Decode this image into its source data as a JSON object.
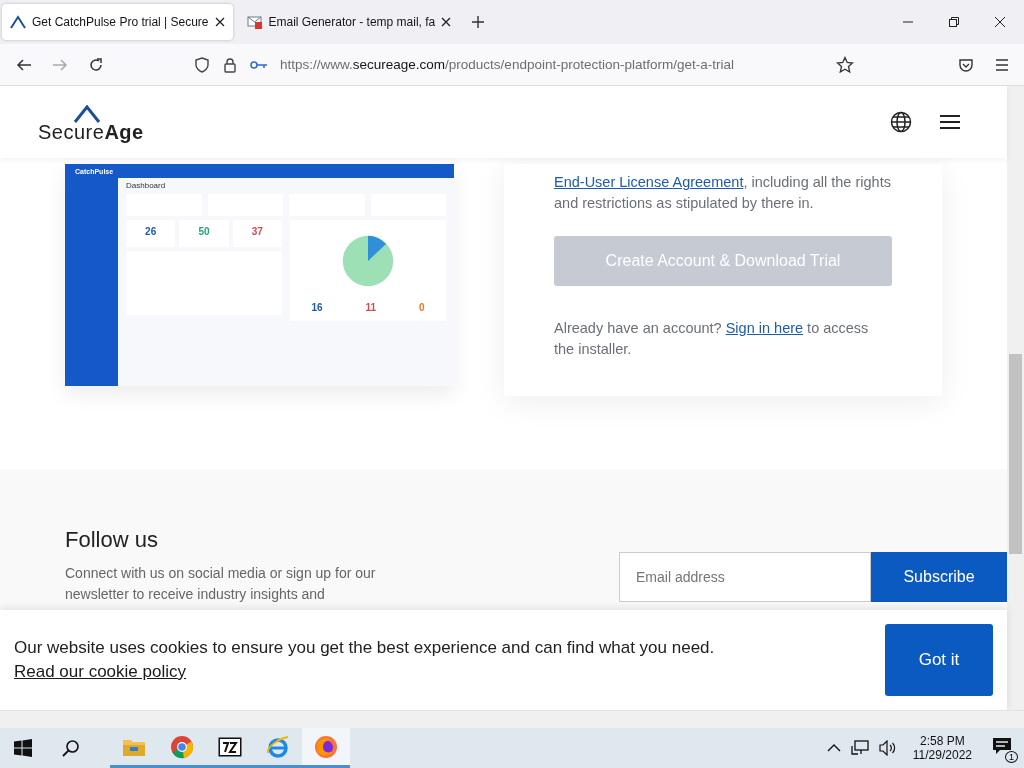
{
  "tabs": [
    {
      "title": "Get CatchPulse Pro trial | Secure",
      "kind": "secureage",
      "selected": true
    },
    {
      "title": "Email Generator - temp mail, fa",
      "kind": "mail",
      "selected": false
    }
  ],
  "address_bar": {
    "prefix": "https://www.",
    "host": "secureage.com",
    "path": "/products/endpoint-protection-platform/get-a-trial"
  },
  "site_header": {
    "logo": "Secure**Age**"
  },
  "dashboard_preview": {
    "brand": "CatchPulse",
    "title": "Dashboard",
    "counts": [
      "26",
      "50",
      "37"
    ],
    "totals": [
      "16",
      "11",
      "0"
    ]
  },
  "trial_card": {
    "agreement_link": "End-User License Agreement",
    "agreement_text": ", including all the rights and restrictions as stipulated by there in.",
    "button": {
      "label": "Create Account & Download Trial",
      "disabled": true
    },
    "signin_before": "Already have an account?",
    "signin_link": "Sign in here",
    "signin_after": "to access the installer."
  },
  "follow": {
    "heading": "Follow us",
    "text": "Connect with us on social media or sign up for our newsletter to receive industry insights and",
    "email_placeholder": "Email address",
    "subscribe": "Subscribe"
  },
  "cookie_banner": {
    "text": "Our website uses cookies to ensure you get the best experience and can find what you need.",
    "link": "Read our cookie policy",
    "button": "Got it"
  },
  "taskbar": {
    "apps": [
      {
        "kind": "explorer",
        "active": false
      },
      {
        "kind": "chrome",
        "active": false
      },
      {
        "kind": "archive",
        "active": false
      },
      {
        "kind": "ie",
        "active": false
      },
      {
        "kind": "firefox",
        "active": true
      }
    ],
    "time": "2:58 PM",
    "date": "11/29/2022",
    "notifications": "1"
  }
}
